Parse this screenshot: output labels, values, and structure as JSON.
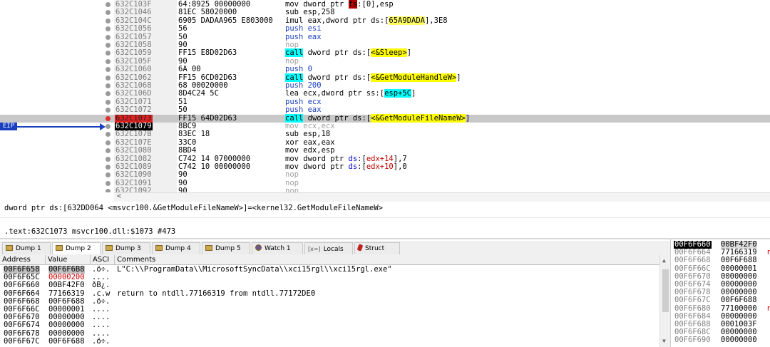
{
  "disasm": {
    "rows": [
      {
        "addr": "632C103F",
        "bytes": "64:8925 00000000",
        "instr": [
          {
            "t": "mov dword ptr "
          },
          {
            "t": "fs",
            "c": "hl-fs"
          },
          {
            "t": ":[0],esp"
          }
        ]
      },
      {
        "addr": "632C1046",
        "bytes": "81EC 58020000",
        "instr": [
          {
            "t": "sub esp,258"
          }
        ]
      },
      {
        "addr": "632C104C",
        "bytes": "6905 DADAA965 E803000",
        "instr": [
          {
            "t": "imul eax,dword ptr ds:["
          },
          {
            "t": "65A9DADA",
            "c": "hl-y"
          },
          {
            "t": "],3E8"
          }
        ]
      },
      {
        "addr": "632C1056",
        "bytes": "56",
        "instr": [
          {
            "t": "push esi",
            "c": "kw-push"
          }
        ]
      },
      {
        "addr": "632C1057",
        "bytes": "50",
        "instr": [
          {
            "t": "push eax",
            "c": "kw-push"
          }
        ]
      },
      {
        "addr": "632C1058",
        "bytes": "90",
        "instr": [
          {
            "t": "nop",
            "c": "kw-nop"
          }
        ]
      },
      {
        "addr": "632C1059",
        "bytes": "FF15 E8D02D63",
        "instr": [
          {
            "t": "call",
            "c": "kw-call"
          },
          {
            "t": " dword ptr ds:["
          },
          {
            "t": "<&Sleep>",
            "c": "sym"
          },
          {
            "t": "]"
          }
        ]
      },
      {
        "addr": "632C105F",
        "bytes": "90",
        "instr": [
          {
            "t": "nop",
            "c": "kw-nop"
          }
        ]
      },
      {
        "addr": "632C1060",
        "bytes": "6A 00",
        "instr": [
          {
            "t": "push 0",
            "c": "kw-push"
          }
        ]
      },
      {
        "addr": "632C1062",
        "bytes": "FF15 6CD02D63",
        "instr": [
          {
            "t": "call",
            "c": "kw-call"
          },
          {
            "t": " dword ptr ds:["
          },
          {
            "t": "<&GetModuleHandleW>",
            "c": "sym"
          },
          {
            "t": "]"
          }
        ]
      },
      {
        "addr": "632C1068",
        "bytes": "68 00020000",
        "instr": [
          {
            "t": "push 200",
            "c": "kw-push"
          }
        ]
      },
      {
        "addr": "632C106D",
        "bytes": "8D4C24 5C",
        "instr": [
          {
            "t": "lea ecx,dword ptr ss:["
          },
          {
            "t": "esp+5C",
            "c": "hl-c"
          },
          {
            "t": "]"
          }
        ]
      },
      {
        "addr": "632C1071",
        "bytes": "51",
        "instr": [
          {
            "t": "push ecx",
            "c": "kw-push"
          }
        ]
      },
      {
        "addr": "632C1072",
        "bytes": "50",
        "instr": [
          {
            "t": "push eax",
            "c": "kw-push"
          }
        ]
      },
      {
        "addr": "632C1073",
        "bytes": "FF15 64D02D63",
        "bp": true,
        "instr": [
          {
            "t": "call",
            "c": "kw-call"
          },
          {
            "t": " dword ptr ds:["
          },
          {
            "t": "<&GetModuleFileNameW>",
            "c": "sym"
          },
          {
            "t": "]"
          }
        ]
      },
      {
        "addr": "632C1079",
        "bytes": "8BC9",
        "eip": true,
        "instr": [
          {
            "t": "mov ecx,ecx",
            "c": "kw-nop"
          }
        ]
      },
      {
        "addr": "632C107B",
        "bytes": "83EC 18",
        "instr": [
          {
            "t": "sub esp,18"
          }
        ]
      },
      {
        "addr": "632C107E",
        "bytes": "33C0",
        "instr": [
          {
            "t": "xor eax,eax"
          }
        ]
      },
      {
        "addr": "632C1080",
        "bytes": "8BD4",
        "instr": [
          {
            "t": "mov edx,esp"
          }
        ]
      },
      {
        "addr": "632C1082",
        "bytes": "C742 14 07000000",
        "instr": [
          {
            "t": "mov dword ptr "
          },
          {
            "t": "ds",
            "c": "blue"
          },
          {
            "t": ":["
          },
          {
            "t": "edx+14",
            "c": "red"
          },
          {
            "t": "],7"
          }
        ]
      },
      {
        "addr": "632C1089",
        "bytes": "C742 10 00000000",
        "instr": [
          {
            "t": "mov dword ptr "
          },
          {
            "t": "ds",
            "c": "blue"
          },
          {
            "t": ":["
          },
          {
            "t": "edx+10",
            "c": "red"
          },
          {
            "t": "],0"
          }
        ]
      },
      {
        "addr": "632C1090",
        "bytes": "90",
        "instr": [
          {
            "t": "nop",
            "c": "kw-nop"
          }
        ]
      },
      {
        "addr": "632C1091",
        "bytes": "90",
        "instr": [
          {
            "t": "nop",
            "c": "kw-nop"
          }
        ]
      },
      {
        "addr": "632C1092",
        "bytes": "90",
        "instr": [
          {
            "t": "nop",
            "c": "kw-nop"
          }
        ]
      }
    ],
    "eip_label": "EIP",
    "scroll_left": "<"
  },
  "info": {
    "line1": "dword ptr ds:[632DD064 <msvcr100.&GetModuleFileNameW>]=<kernel32.GetModuleFileNameW>",
    "line2": ".text:632C1073 msvcr100.dll:$1073 #473"
  },
  "tabs": [
    {
      "label": "Dump 1",
      "icon": "dump-icon"
    },
    {
      "label": "Dump 2",
      "icon": "dump-icon",
      "active": true
    },
    {
      "label": "Dump 3",
      "icon": "dump-icon"
    },
    {
      "label": "Dump 4",
      "icon": "dump-icon"
    },
    {
      "label": "Dump 5",
      "icon": "dump-icon"
    },
    {
      "label": "Watch 1",
      "icon": "watch-icon"
    },
    {
      "label": "Locals",
      "icon": "locals-icon",
      "glyph": "[x=]"
    },
    {
      "label": "Struct",
      "icon": "struct-icon"
    }
  ],
  "dump": {
    "headers": {
      "address": "Address",
      "value": "Value",
      "ascii": "ASCI",
      "comments": "Comments"
    },
    "rows": [
      {
        "addr": "00F6F658",
        "value": "00F6F6B8",
        "ascii": ".ö÷.",
        "comment": "L\"C:\\\\ProgramData\\\\MicrosoftSyncData\\\\xci15rgl\\\\xci15rgl.exe\"",
        "sel": true
      },
      {
        "addr": "00F6F65C",
        "value": "00000200",
        "ascii": "....",
        "comment": "",
        "red": true
      },
      {
        "addr": "00F6F660",
        "value": "00BF42F0",
        "ascii": "ðB¿.",
        "comment": ""
      },
      {
        "addr": "00F6F664",
        "value": "77166319",
        "ascii": ".c.w",
        "comment": "return to ntdll.77166319 from ntdll.77172DE0"
      },
      {
        "addr": "00F6F668",
        "value": "00F6F688",
        "ascii": ".ö÷.",
        "comment": ""
      },
      {
        "addr": "00F6F66C",
        "value": "00000001",
        "ascii": "....",
        "comment": ""
      },
      {
        "addr": "00F6F670",
        "value": "00000000",
        "ascii": "....",
        "comment": ""
      },
      {
        "addr": "00F6F674",
        "value": "00000000",
        "ascii": "....",
        "comment": ""
      },
      {
        "addr": "00F6F678",
        "value": "00000000",
        "ascii": "....",
        "comment": ""
      },
      {
        "addr": "00F6F67C",
        "value": "00F6F688",
        "ascii": ".ö÷.",
        "comment": ""
      }
    ]
  },
  "stack": {
    "rows": [
      {
        "addr": "00F6F660",
        "value": "00BF42F0",
        "top": true
      },
      {
        "addr": "00F6F664",
        "value": "77166319",
        "mark": "r"
      },
      {
        "addr": "00F6F668",
        "value": "00F6F688"
      },
      {
        "addr": "00F6F66C",
        "value": "00000001"
      },
      {
        "addr": "00F6F670",
        "value": "00000000"
      },
      {
        "addr": "00F6F674",
        "value": "00000000"
      },
      {
        "addr": "00F6F678",
        "value": "00000000"
      },
      {
        "addr": "00F6F67C",
        "value": "00F6F688"
      },
      {
        "addr": "00F6F680",
        "value": "77100000",
        "mark": "r"
      },
      {
        "addr": "00F6F684",
        "value": "00000000"
      },
      {
        "addr": "00F6F688",
        "value": "0001003F"
      },
      {
        "addr": "00F6F68C",
        "value": "00000000"
      },
      {
        "addr": "00F6F690",
        "value": "00000000"
      }
    ]
  }
}
